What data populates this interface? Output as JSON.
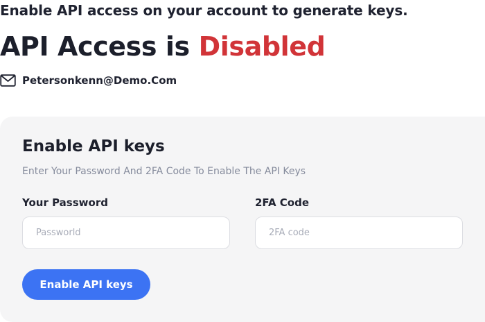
{
  "header": {
    "subtitle": "Enable API access on your account to generate keys.",
    "title_prefix": "API Access is",
    "title_status": "Disabled",
    "status_color": "#d13438",
    "email_icon": "mail-icon",
    "email": "Petersonkenn@Demo.Com"
  },
  "form": {
    "title": "Enable API keys",
    "description": "Enter Your Password And 2FA Code To Enable The API Keys",
    "password": {
      "label": "Your Password",
      "placeholder": "Passworld",
      "value": ""
    },
    "twofa": {
      "label": "2FA Code",
      "placeholder": "2FA code",
      "value": ""
    },
    "submit_label": "Enable API keys",
    "accent_color": "#3c73f3"
  }
}
